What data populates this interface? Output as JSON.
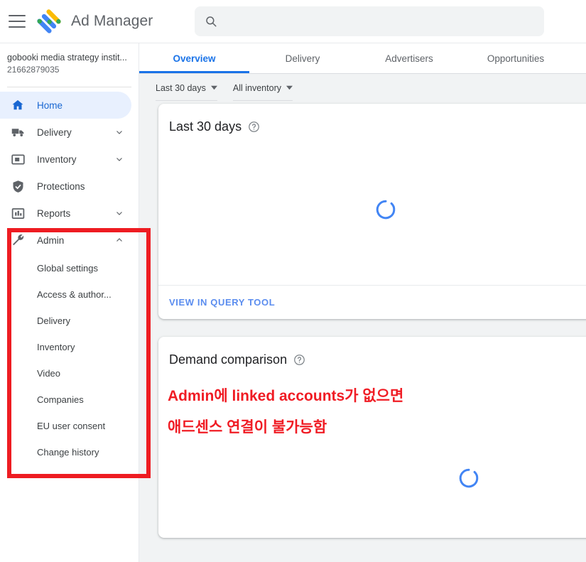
{
  "header": {
    "menu_icon": "hamburger-menu-icon",
    "logo_icon": "google-ad-manager-logo",
    "title": "Ad Manager",
    "search": {
      "icon": "search-icon",
      "value": "",
      "placeholder": ""
    }
  },
  "sidebar": {
    "account": {
      "name": "gobooki media strategy instit...",
      "id": "21662879035"
    },
    "items": [
      {
        "label": "Home",
        "icon": "home-icon",
        "active": true,
        "expandable": false,
        "chevron": ""
      },
      {
        "label": "Delivery",
        "icon": "truck-icon",
        "active": false,
        "expandable": true,
        "chevron": "chevron-down-icon"
      },
      {
        "label": "Inventory",
        "icon": "ad-unit-icon",
        "active": false,
        "expandable": true,
        "chevron": "chevron-down-icon"
      },
      {
        "label": "Protections",
        "icon": "shield-check-icon",
        "active": false,
        "expandable": false,
        "chevron": ""
      },
      {
        "label": "Reports",
        "icon": "bar-chart-icon",
        "active": false,
        "expandable": true,
        "chevron": "chevron-down-icon"
      },
      {
        "label": "Admin",
        "icon": "wrench-icon",
        "active": false,
        "expandable": true,
        "chevron": "chevron-up-icon"
      }
    ],
    "admin_submenu": [
      {
        "label": "Global settings"
      },
      {
        "label": "Access & author..."
      },
      {
        "label": "Delivery"
      },
      {
        "label": "Inventory"
      },
      {
        "label": "Video"
      },
      {
        "label": "Companies"
      },
      {
        "label": "EU user consent"
      },
      {
        "label": "Change history"
      }
    ]
  },
  "main": {
    "tabs": [
      {
        "label": "Overview",
        "active": true
      },
      {
        "label": "Delivery",
        "active": false
      },
      {
        "label": "Advertisers",
        "active": false
      },
      {
        "label": "Opportunities",
        "active": false
      }
    ],
    "filters": [
      {
        "label": "Last 30 days",
        "icon": "chevron-down-icon"
      },
      {
        "label": "All inventory",
        "icon": "chevron-down-icon"
      }
    ],
    "cards": [
      {
        "title": "Last 30 days",
        "help_icon": "help-circle-icon",
        "loading_icon": "loading-spinner-icon",
        "footer_link": "VIEW IN QUERY TOOL"
      },
      {
        "title": "Demand comparison",
        "help_icon": "help-circle-icon",
        "loading_icon": "loading-spinner-icon",
        "footer_link": ""
      }
    ]
  },
  "annotations": {
    "box_color": "#ee1c22",
    "text_color": "#f01c24",
    "line1": "Admin에 linked accounts가 없으면",
    "line2": "애드센스 연결이 불가능함"
  },
  "colors": {
    "accent": "#1a73e8",
    "active_nav_bg": "#e8f0fe",
    "active_nav_text": "#1967d2",
    "page_bg": "#f1f3f4",
    "spinner": "#4285f4",
    "link": "#5b8def",
    "annotation_red": "#ee1c22"
  }
}
